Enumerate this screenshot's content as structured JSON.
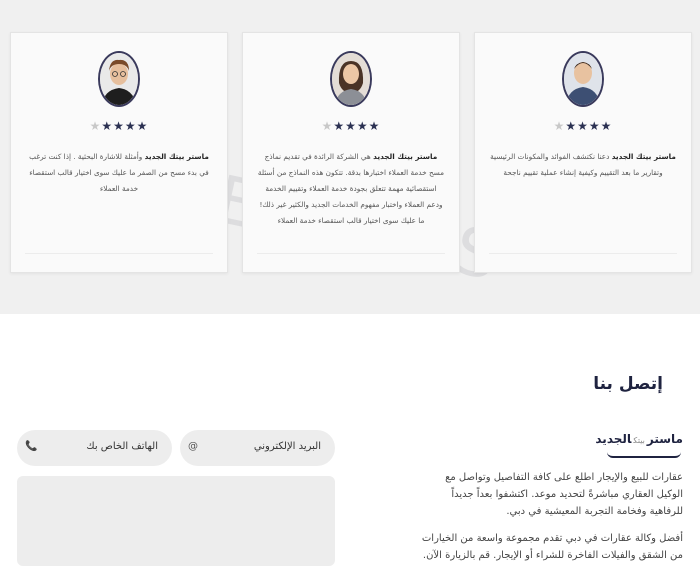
{
  "reviews": {
    "watermark": "REVIEWS",
    "stars_total": 5,
    "cards": [
      {
        "brand": "ماستر بيتك الجديد",
        "text": "دعنا نكتشف الفوائد والمكونات الرئيسية وتقارير ما بعد التقييم وكيفية إنشاء عملية تقييم ناجحة",
        "rating": 4
      },
      {
        "brand": "ماستر بيتك الجديد",
        "text": "هي الشركة الرائدة في تقديم نماذج مسح خدمة العملاء اختبارها بدقة. تتكون هذه النماذج من أسئلة استقصائية مهمة تتعلق بجودة خدمة العملاء وتقييم الخدمة ودعم العملاء واختبار مفهوم الخدمات الجديد والكثير غير ذلك! ما عليك سوى اختيار قالب استقصاء خدمة العملاء",
        "rating": 4
      },
      {
        "brand": "ماستر بيتك الجديد",
        "text": "وأمثلة للاشارة البحثية . إذا كنت ترغب في بدء مسح من الصفر ما عليك سوى اختيار قالب استقصاء خدمة العملاء",
        "rating": 4
      }
    ]
  },
  "contact": {
    "title": "إتصل بنا",
    "logo": {
      "part1": "ماستر",
      "part2": "بيتك",
      "part3": "الجديد"
    },
    "about_p1": "عقارات للبيع والإيجار اطلع على كافة التفاصيل وتواصل مع الوكيل العقاري مباشرةً لتحديد موعد. اكتشفوا بعداً جديداً للرفاهية وفخامة التجربة المعيشية في دبي.",
    "about_p2": "أفضل وكالة عقارات في دبي تقدم مجموعة واسعة من الخيارات من الشقق والفيلات الفاخرة للشراء أو الإيجار. قم بالزيارة الآن.",
    "email_label": "البريد الإلكتروني",
    "email_icon": "@",
    "phone_label": "الهاتف الخاص بك",
    "phone_icon": "📞"
  }
}
